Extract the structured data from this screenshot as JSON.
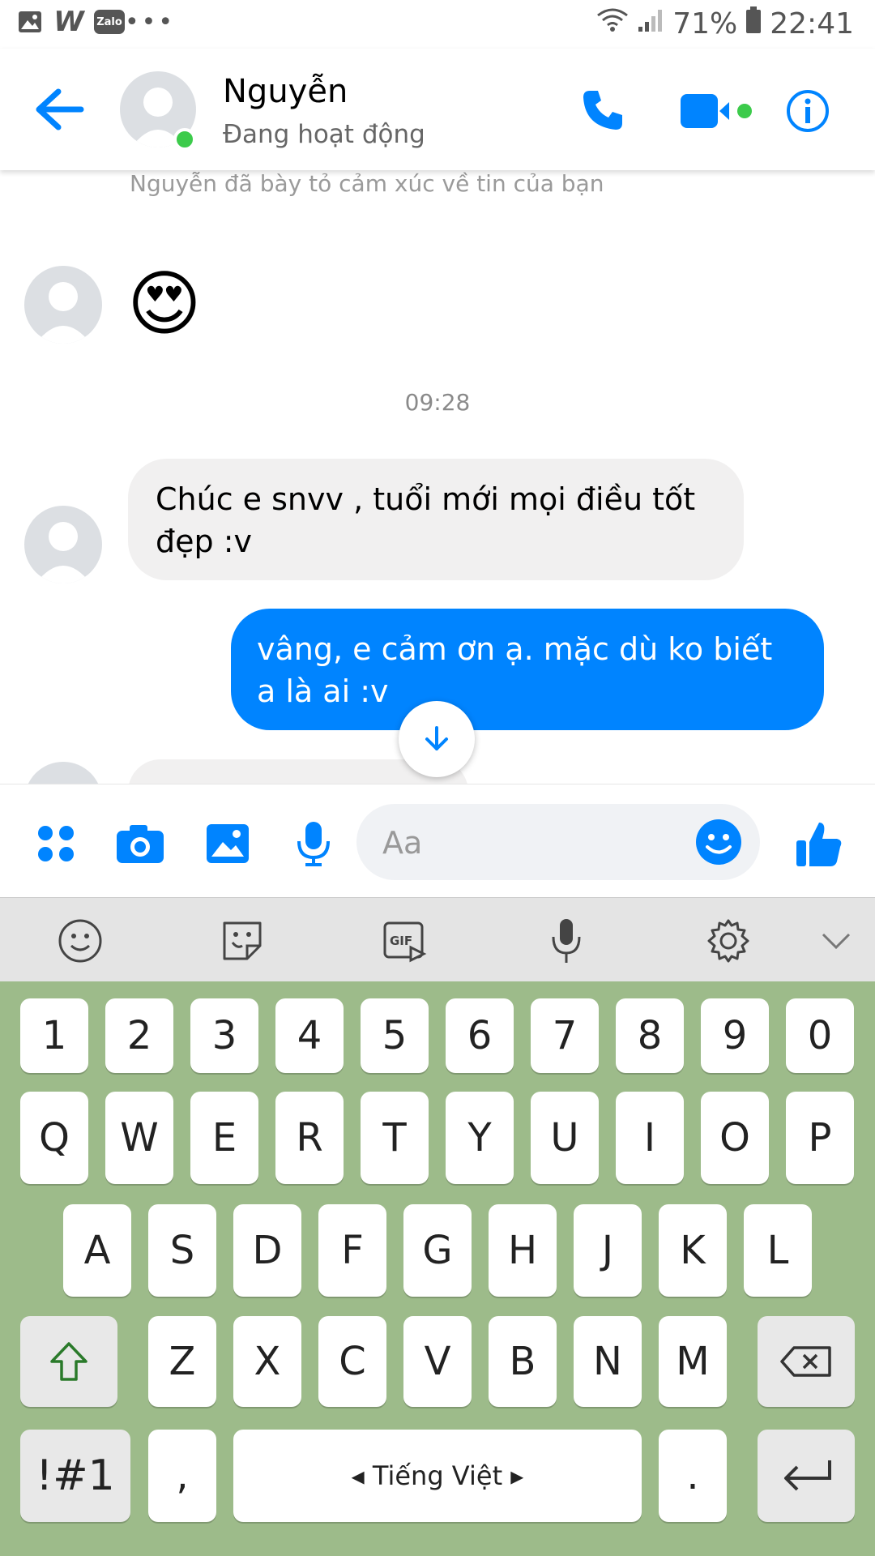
{
  "status_bar": {
    "left_icons": [
      "image-icon",
      "w-app-icon",
      "zalo-icon",
      "more-dots-icon"
    ],
    "zalo_label": "Zalo",
    "w_label": "W",
    "dots_label": "•••",
    "battery_percent": "71%",
    "time": "22:41"
  },
  "header": {
    "contact_name": "Nguyễn",
    "contact_status": "Đang hoạt động"
  },
  "chat": {
    "reaction_notice": "Nguyễn đã bày tỏ cảm xúc về tin của bạn",
    "reaction_emoji": "😍",
    "timestamp": "09:28",
    "messages": [
      {
        "direction": "incoming",
        "text": "Chúc e snvv , tuổi mới mọi điều tốt đẹp :v"
      },
      {
        "direction": "outgoing",
        "text": "vâng, e cảm ơn ạ. mặc dù ko biết a là ai :v"
      }
    ]
  },
  "composer": {
    "placeholder": "Aa"
  },
  "keyboard": {
    "number_row": [
      "1",
      "2",
      "3",
      "4",
      "5",
      "6",
      "7",
      "8",
      "9",
      "0"
    ],
    "row1": [
      "Q",
      "W",
      "E",
      "R",
      "T",
      "Y",
      "U",
      "I",
      "O",
      "P"
    ],
    "row2": [
      "A",
      "S",
      "D",
      "F",
      "G",
      "H",
      "J",
      "K",
      "L"
    ],
    "row3": [
      "Z",
      "X",
      "C",
      "V",
      "B",
      "N",
      "M"
    ],
    "symbols_key": "!#1",
    "comma_key": ",",
    "space_label": "◂  Tiếng Việt  ▸",
    "period_key": "."
  },
  "colors": {
    "accent_blue": "#0084ff",
    "online_green": "#3ccb4b",
    "keyboard_bg": "#9dbb8a"
  }
}
